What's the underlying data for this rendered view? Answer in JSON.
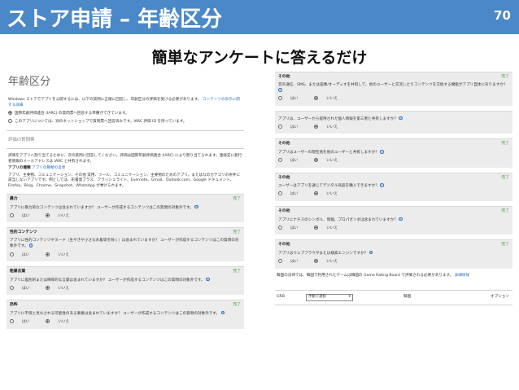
{
  "header": {
    "title": "ストア申請 – 年齢区分",
    "page_number": "70"
  },
  "subtitle": "簡単なアンケートに答えるだけ",
  "left": {
    "section_title": "年齢区分",
    "intro_text": "Windows ストアでアプリを公開するには、以下の質問に正確に回答し、年齢区分の評価を受ける必要があります。",
    "intro_link": "コンテンツの表示に関する詳細",
    "radio_iarc": "国際年齢評価連合 (IARC) の質問票へ回答する準備ができています。",
    "radio_other": "このアプリについては、別のネットショップで質問票へ回答済みです。IARC 評価 ID を持っています。",
    "eval_subhead": "評価の質問票",
    "eval_text": "評価をアプリへ割り当てるために、次の質問に回答してください。評価は国際年齢評価連合 (IARC) により割り当てられます。連絡先に発行者情報のメールアドレスは IARC と共有されます。",
    "type_label": "アプリの種類",
    "type_link": "アプリの種類の変更",
    "type_desc": "アプリ、主要物、コミュニケーション、その他 実用、ツール、コミュニケーション、主要物のためのアプリ。またはなのカテゴリの条件に該当しないアプリです。例としては、形書発プラス、フラッシュライト、Evernote、Gmail、Outlook.com、Google ドキュメント、Firefox、Bing、Chrome、Snapshot、WhatsApp が挙げられます。",
    "questions": [
      {
        "category": "暴力",
        "status": "完了",
        "text": "アプリに暴力的なコンテンツは含まれていますか？ ユーザーが作成するコンテンツはこの質問の対象外です。",
        "yes": "はい",
        "no": "いいえ"
      },
      {
        "category": "性的コンテンツ",
        "status": "完了",
        "text": "アプリに性的コンテンツやヌード（生やきや小さな水着等を除く）は含まれていますか？ ユーザーが作成するコンテンツはこの質問の対象外です。",
        "yes": "はい",
        "no": "いいえ"
      },
      {
        "category": "粗暴言葉",
        "status": "完了",
        "text": "アプリに差別的または侮辱的な言葉は含まれていますか？ ユーザーが作成するコンテンツはこの質問の対象外です。",
        "yes": "はい",
        "no": "いいえ"
      },
      {
        "category": "恐怖",
        "status": "完了",
        "text": "アプリに不快と見なされる可能性のある要素は含まれていますか？ ユーザーが作成するコンテンツはこの質問の対象外です。",
        "yes": "はい",
        "no": "いいえ"
      }
    ]
  },
  "right": {
    "questions": [
      {
        "category": "その他",
        "status": "完了",
        "text": "音声通信、SMS、または画像/オーディオを共有して、他のユーザーと交流したりコンテンツを交換する機能がアプリ自体にありますか？",
        "yes": "はい",
        "no": "いいえ"
      },
      {
        "category": "",
        "status": "",
        "text": "アプリは、ユーザーから提供された個人情報を第三者と共有しますか？",
        "yes": "はい",
        "no": "いいえ"
      },
      {
        "category": "その他",
        "status": "完了",
        "text": "アプリはユーザーの現在地を他のユーザーと共有しますか？",
        "yes": "はい",
        "no": "いいえ"
      },
      {
        "category": "その他",
        "status": "完了",
        "text": "ユーザーはアプリを通じてデジタル商品を購入できますか？",
        "yes": "はい",
        "no": "いいえ"
      },
      {
        "category": "その他",
        "status": "完了",
        "text": "アプリにナチスのシンボル、情報、プロパガンダは含まれていますか？",
        "yes": "はい",
        "no": "いいえ"
      },
      {
        "category": "その他",
        "status": "完了",
        "text": "アプリはウェブブラウザまたは検索エンジンですか？",
        "yes": "はい",
        "no": "いいえ"
      }
    ],
    "korea_text": "韓国の法律では、韓国で利用されたゲームは韓国の Game Rating Board で評価される必要があります。",
    "korea_link": "詳細情報",
    "grb_label": "GRB",
    "grb_select": "手動で選択",
    "col_rating": "韓国",
    "col_option": "オプション"
  }
}
